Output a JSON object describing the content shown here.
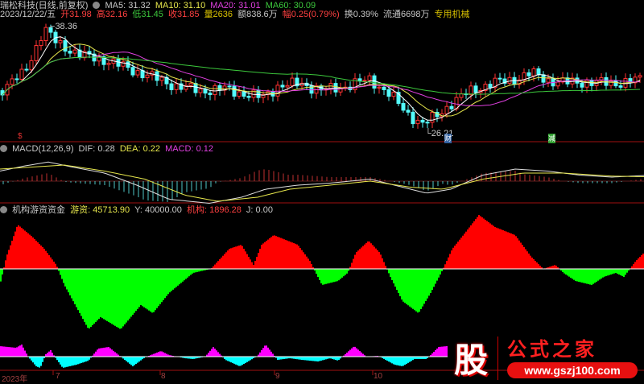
{
  "header": {
    "title": "瑞松科技(日线,前复权)",
    "ma5": "MA5: 31.32",
    "ma10": "MA10: 31.10",
    "ma20": "MA20: 31.01",
    "ma60": "MA60: 30.09",
    "date": "2023/12/22/五",
    "open": "开31.98",
    "high": "高32.16",
    "low": "低31.45",
    "close": "收31.85",
    "volume": "量2636",
    "amount": "额838.6万",
    "change": "幅0.25(0.79%)",
    "turnover": "换0.39%",
    "float": "流通6698万",
    "sector": "专用机械"
  },
  "main_chart": {
    "high_label": "38.36",
    "low_label": "26.21",
    "marker_cai": "财",
    "marker_jian": "减",
    "marker_s": "$",
    "price_keypoints": [
      [
        0,
        31
      ],
      [
        30,
        33
      ],
      [
        55,
        38
      ],
      [
        70,
        36.5
      ],
      [
        100,
        35
      ],
      [
        130,
        34.5
      ],
      [
        160,
        33.5
      ],
      [
        190,
        32.5
      ],
      [
        220,
        31.5
      ],
      [
        250,
        31
      ],
      [
        280,
        31.2
      ],
      [
        310,
        30.5
      ],
      [
        325,
        30.2
      ],
      [
        345,
        31.5
      ],
      [
        375,
        31.8
      ],
      [
        400,
        31
      ],
      [
        430,
        31.5
      ],
      [
        460,
        32.3
      ],
      [
        485,
        30.5
      ],
      [
        505,
        28.5
      ],
      [
        525,
        27.2
      ],
      [
        540,
        28
      ],
      [
        560,
        29.5
      ],
      [
        585,
        31
      ],
      [
        610,
        31.8
      ],
      [
        640,
        32.3
      ],
      [
        660,
        33
      ],
      [
        680,
        32.2
      ],
      [
        700,
        31.9
      ],
      [
        730,
        32
      ],
      [
        760,
        31.8
      ],
      [
        800,
        32.3
      ]
    ]
  },
  "macd": {
    "label": "MACD(12,26,9)",
    "dif": "DIF: 0.28",
    "dea": "DEA: 0.22",
    "macd": "MACD: 0.12",
    "dif_keypoints": [
      [
        0,
        0.5
      ],
      [
        30,
        0.75
      ],
      [
        60,
        0.95
      ],
      [
        90,
        0.7
      ],
      [
        130,
        0.4
      ],
      [
        170,
        -0.2
      ],
      [
        210,
        -0.9
      ],
      [
        260,
        -1.1
      ],
      [
        300,
        -0.8
      ],
      [
        330,
        -0.4
      ],
      [
        370,
        -0.2
      ],
      [
        410,
        -0.1
      ],
      [
        460,
        0.1
      ],
      [
        500,
        -0.3
      ],
      [
        530,
        -0.6
      ],
      [
        560,
        -0.4
      ],
      [
        600,
        0.3
      ],
      [
        640,
        0.6
      ],
      [
        680,
        0.5
      ],
      [
        720,
        0.3
      ],
      [
        760,
        0.2
      ],
      [
        800,
        0.28
      ]
    ],
    "dea_keypoints": [
      [
        0,
        0.6
      ],
      [
        40,
        0.7
      ],
      [
        80,
        0.8
      ],
      [
        130,
        0.5
      ],
      [
        180,
        0.1
      ],
      [
        230,
        -0.7
      ],
      [
        270,
        -1.0
      ],
      [
        320,
        -0.8
      ],
      [
        360,
        -0.4
      ],
      [
        410,
        -0.2
      ],
      [
        460,
        0
      ],
      [
        510,
        -0.3
      ],
      [
        550,
        -0.4
      ],
      [
        600,
        0.1
      ],
      [
        650,
        0.4
      ],
      [
        700,
        0.4
      ],
      [
        760,
        0.25
      ],
      [
        800,
        0.22
      ]
    ]
  },
  "fund": {
    "label": "机构游资资金",
    "hot": "游资: 45713.90",
    "y": "Y: 40000.00",
    "inst": "机构: 1896.28",
    "j": "J: 0.00",
    "keypoints": [
      [
        0,
        -20
      ],
      [
        8,
        15
      ],
      [
        22,
        55
      ],
      [
        40,
        40
      ],
      [
        55,
        25
      ],
      [
        70,
        5
      ],
      [
        80,
        -20
      ],
      [
        110,
        -75
      ],
      [
        125,
        -60
      ],
      [
        150,
        -75
      ],
      [
        175,
        -45
      ],
      [
        190,
        -55
      ],
      [
        210,
        -30
      ],
      [
        240,
        -5
      ],
      [
        262,
        0
      ],
      [
        285,
        25
      ],
      [
        300,
        30
      ],
      [
        315,
        5
      ],
      [
        325,
        30
      ],
      [
        340,
        42
      ],
      [
        370,
        30
      ],
      [
        385,
        10
      ],
      [
        400,
        -20
      ],
      [
        420,
        -15
      ],
      [
        432,
        -5
      ],
      [
        442,
        20
      ],
      [
        458,
        35
      ],
      [
        472,
        20
      ],
      [
        485,
        -10
      ],
      [
        500,
        -40
      ],
      [
        520,
        -55
      ],
      [
        535,
        -30
      ],
      [
        548,
        -5
      ],
      [
        562,
        25
      ],
      [
        578,
        45
      ],
      [
        595,
        67
      ],
      [
        615,
        52
      ],
      [
        640,
        42
      ],
      [
        660,
        15
      ],
      [
        675,
        0
      ],
      [
        690,
        5
      ],
      [
        700,
        -5
      ],
      [
        715,
        -15
      ],
      [
        735,
        -20
      ],
      [
        750,
        -10
      ],
      [
        765,
        -5
      ],
      [
        775,
        -10
      ],
      [
        790,
        10
      ],
      [
        800,
        20
      ]
    ],
    "osc_keypoints": [
      [
        0,
        13
      ],
      [
        20,
        11
      ],
      [
        27,
        15
      ],
      [
        35,
        0
      ],
      [
        45,
        -12
      ],
      [
        50,
        -14
      ],
      [
        57,
        3
      ],
      [
        63,
        8
      ],
      [
        68,
        0
      ],
      [
        78,
        -14
      ],
      [
        95,
        -10
      ],
      [
        110,
        -5
      ],
      [
        122,
        10
      ],
      [
        135,
        12
      ],
      [
        150,
        0
      ],
      [
        165,
        -12
      ],
      [
        180,
        -1
      ],
      [
        200,
        7
      ],
      [
        210,
        2
      ],
      [
        230,
        -2
      ],
      [
        240,
        -3
      ],
      [
        255,
        0
      ],
      [
        265,
        12
      ],
      [
        280,
        -4
      ],
      [
        298,
        -12
      ],
      [
        310,
        -5
      ],
      [
        320,
        1
      ],
      [
        330,
        15
      ],
      [
        345,
        -4
      ],
      [
        360,
        -2
      ],
      [
        375,
        -4
      ],
      [
        395,
        -6
      ],
      [
        410,
        -2
      ],
      [
        420,
        -5
      ],
      [
        440,
        13
      ],
      [
        455,
        0
      ],
      [
        470,
        1
      ],
      [
        490,
        -10
      ],
      [
        500,
        -12
      ],
      [
        515,
        -3
      ],
      [
        530,
        -3
      ],
      [
        545,
        12
      ],
      [
        555,
        13
      ]
    ]
  },
  "xaxis": {
    "labels": [
      "2023年",
      "7",
      "8",
      "9",
      "10"
    ]
  },
  "logo": {
    "char": "股",
    "name": "公式之家",
    "url": "www.gszj100.com"
  },
  "colors": {
    "up": "#ff3232",
    "down": "#54fcfc",
    "ma5": "#ffffff",
    "ma10": "#e6e64c",
    "ma20": "#e040e0",
    "ma60": "#3cc83c",
    "fund_up": "#ff0000",
    "fund_down": "#00ff00",
    "osc_up": "#ff00ff",
    "osc_down": "#00ffff"
  }
}
